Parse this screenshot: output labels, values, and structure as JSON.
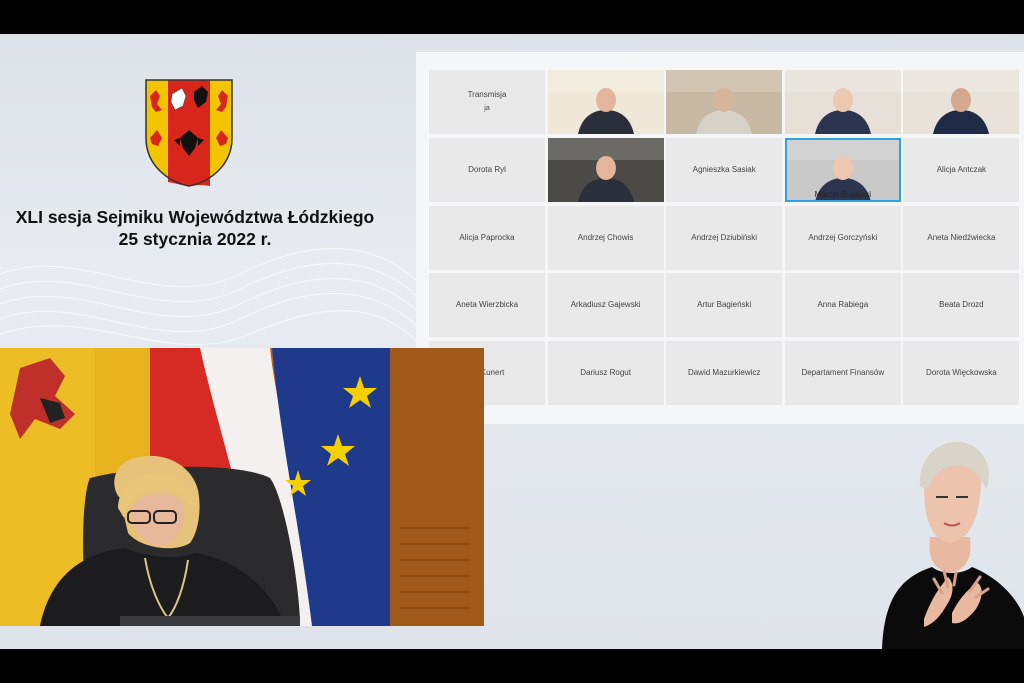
{
  "session": {
    "title_line1": "XLI sesja Sejmiku Województwa Łódzkiego",
    "title_line2": "25 stycznia 2022 r."
  },
  "participants": [
    {
      "name": "Transmisja",
      "sub": "ja",
      "video": false
    },
    {
      "name": "",
      "video": true
    },
    {
      "name": "",
      "video": true
    },
    {
      "name": "",
      "video": true
    },
    {
      "name": "",
      "video": true
    },
    {
      "name": "Dorota Ryl",
      "video": false
    },
    {
      "name": "",
      "video": true
    },
    {
      "name": "Agnieszka Sasiak",
      "video": false
    },
    {
      "name": "Marcin Bugajski",
      "video": true,
      "active": true
    },
    {
      "name": "Alicja Antczak",
      "video": false
    },
    {
      "name": "Alicja Paprocka",
      "video": false
    },
    {
      "name": "Andrzej Chowis",
      "video": false
    },
    {
      "name": "Andrzej Dziubiński",
      "video": false
    },
    {
      "name": "Andrzej Gorczyński",
      "video": false
    },
    {
      "name": "Aneta Niedźwiecka",
      "video": false
    },
    {
      "name": "Aneta Wierzbicka",
      "video": false
    },
    {
      "name": "Arkadiusz Gajewski",
      "video": false
    },
    {
      "name": "Artur Bagieński",
      "video": false
    },
    {
      "name": "Anna Rabiega",
      "video": false
    },
    {
      "name": "Beata Drozd",
      "video": false
    },
    {
      "name": "an Kunert",
      "video": false
    },
    {
      "name": "Dariusz Rogut",
      "video": false
    },
    {
      "name": "Dawid Mazurkiewicz",
      "video": false
    },
    {
      "name": "Departament Finansów",
      "video": false
    },
    {
      "name": "Dorota Więckowska",
      "video": false
    }
  ],
  "colors": {
    "crest_yellow": "#f2c500",
    "crest_red": "#d8261d",
    "active_border": "#2ea3e0",
    "eu_blue": "#1f3a8a",
    "eu_star": "#f5d000"
  },
  "icons": {
    "crest": "voivodeship-coat-of-arms-icon"
  }
}
